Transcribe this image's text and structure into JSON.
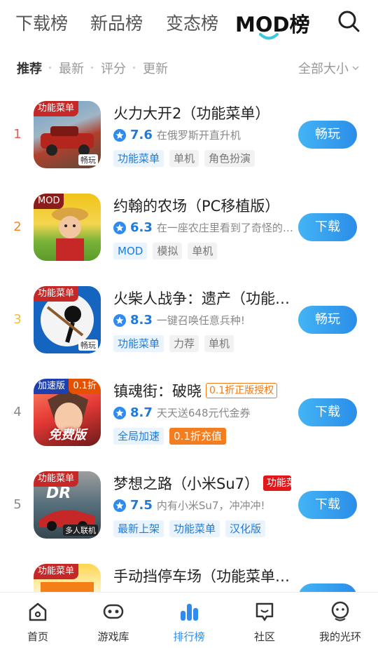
{
  "top_tabs": [
    {
      "label": "下载榜"
    },
    {
      "label": "新品榜"
    },
    {
      "label": "变态榜"
    },
    {
      "label": "MOD榜",
      "active": true
    }
  ],
  "sub_filters": [
    {
      "label": "推荐",
      "active": true
    },
    {
      "label": "最新"
    },
    {
      "label": "评分"
    },
    {
      "label": "更新"
    }
  ],
  "size_filter": "全部大小",
  "games": [
    {
      "rank": "1",
      "rank_color": "#e85a4f",
      "icon_tag": "功能菜单",
      "icon_badge": "畅玩",
      "title": "火力大开2（功能菜单）",
      "score": "7.6",
      "desc": "在俄罗斯开直升机",
      "tags": [
        {
          "label": "功能菜单",
          "style": "blue"
        },
        {
          "label": "单机"
        },
        {
          "label": "角色扮演"
        }
      ],
      "action": "畅玩"
    },
    {
      "rank": "2",
      "rank_color": "#f08a24",
      "icon_tag": "MOD",
      "title": "约翰的农场（PC移植版）",
      "score": "6.3",
      "desc": "在一座农庄里看到了奇怪的…",
      "tags": [
        {
          "label": "MOD",
          "style": "blue"
        },
        {
          "label": "模拟"
        },
        {
          "label": "单机"
        }
      ],
      "action": "下载"
    },
    {
      "rank": "3",
      "rank_color": "#f2c12e",
      "icon_tag": "功能菜单",
      "icon_badge": "畅玩",
      "title": "火柴人战争：遗产（功能…",
      "score": "8.3",
      "desc": "一键召唤任意兵种!",
      "tags": [
        {
          "label": "功能菜单",
          "style": "blue"
        },
        {
          "label": "力荐"
        },
        {
          "label": "单机"
        }
      ],
      "action": "畅玩"
    },
    {
      "rank": "4",
      "rank_color": "#888888",
      "icon_tag": "加速版",
      "icon_tag2": "0.1折",
      "icon_big": "免费版",
      "title": "镇魂街：破晓",
      "title_badge": "0.1折正版授权",
      "score": "8.7",
      "desc": "天天送648元代金券",
      "tags": [
        {
          "label": "全局加速",
          "style": "blue"
        },
        {
          "label": "0.1折充值",
          "style": "orange"
        }
      ],
      "action": "下载"
    },
    {
      "rank": "5",
      "rank_color": "#888888",
      "icon_tag": "功能菜单",
      "icon_badge": "多人联机",
      "title": "梦想之路（小米Su7）",
      "title_badge_red": "功能菜单",
      "score": "7.5",
      "desc": "内有小米Su7，冲冲冲!",
      "tags": [
        {
          "label": "最新上架",
          "style": "blue"
        },
        {
          "label": "功能菜单",
          "style": "blue"
        },
        {
          "label": "汉化版",
          "style": "blue"
        }
      ],
      "action": "下载"
    },
    {
      "rank": "",
      "rank_color": "#888888",
      "icon_tag": "功能菜单",
      "title": "手动挡停车场（功能菜单…",
      "score": "",
      "desc": "",
      "tags": [],
      "action": ""
    }
  ],
  "bottom_nav": [
    {
      "label": "首页",
      "icon": "home-icon"
    },
    {
      "label": "游戏库",
      "icon": "gamepad-icon"
    },
    {
      "label": "排行榜",
      "icon": "ranking-icon",
      "active": true
    },
    {
      "label": "社区",
      "icon": "community-icon"
    },
    {
      "label": "我的光环",
      "icon": "profile-icon"
    }
  ],
  "colors": {
    "accent": "#2f8bf0",
    "button_gradient_start": "#43b4f5",
    "button_gradient_end": "#2b8de8"
  }
}
